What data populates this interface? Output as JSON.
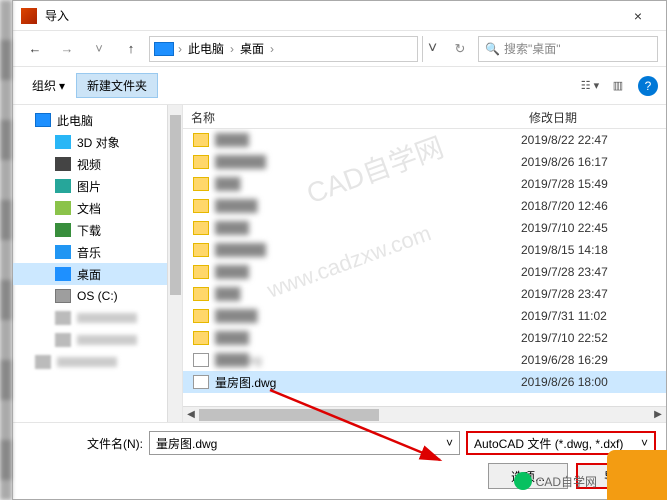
{
  "window": {
    "title": "导入",
    "close": "×"
  },
  "nav": {
    "crumb1": "此电脑",
    "crumb2": "桌面",
    "search_placeholder": "搜索\"桌面\""
  },
  "toolbar": {
    "organize": "组织",
    "newfolder": "新建文件夹"
  },
  "sidebar": {
    "items": [
      {
        "label": "此电脑",
        "cls": "pc",
        "indent": ""
      },
      {
        "label": "3D 对象",
        "cls": "obj",
        "indent": "child"
      },
      {
        "label": "视频",
        "cls": "video",
        "indent": "child"
      },
      {
        "label": "图片",
        "cls": "pic",
        "indent": "child"
      },
      {
        "label": "文档",
        "cls": "doc",
        "indent": "child"
      },
      {
        "label": "下载",
        "cls": "dl",
        "indent": "child"
      },
      {
        "label": "音乐",
        "cls": "music",
        "indent": "child"
      },
      {
        "label": "桌面",
        "cls": "desk",
        "indent": "child",
        "selected": true
      },
      {
        "label": "OS (C:)",
        "cls": "drive",
        "indent": "child"
      },
      {
        "label": "",
        "cls": "blur",
        "indent": "child"
      },
      {
        "label": "",
        "cls": "blur",
        "indent": "child"
      },
      {
        "label": "",
        "cls": "blur",
        "indent": ""
      }
    ]
  },
  "columns": {
    "name": "名称",
    "date": "修改日期"
  },
  "files": [
    {
      "name": "████",
      "date": "2019/8/22 22:47",
      "type": "folder",
      "blur": true
    },
    {
      "name": "██████",
      "date": "2019/8/26 16:17",
      "type": "folder",
      "blur": true
    },
    {
      "name": "███",
      "date": "2019/7/28 15:49",
      "type": "folder",
      "blur": true
    },
    {
      "name": "█████",
      "date": "2018/7/20 12:46",
      "type": "folder",
      "blur": true
    },
    {
      "name": "████",
      "date": "2019/7/10 22:45",
      "type": "folder",
      "blur": true
    },
    {
      "name": "██████",
      "date": "2019/8/15 14:18",
      "type": "folder",
      "blur": true
    },
    {
      "name": "████",
      "date": "2019/7/28 23:47",
      "type": "folder",
      "blur": true
    },
    {
      "name": "███",
      "date": "2019/7/28 23:47",
      "type": "folder",
      "blur": true
    },
    {
      "name": "█████",
      "date": "2019/7/31 11:02",
      "type": "folder",
      "blur": true
    },
    {
      "name": "████",
      "date": "2019/7/10 22:52",
      "type": "folder",
      "blur": true
    },
    {
      "name": "████vg",
      "date": "2019/6/28 16:29",
      "type": "dwg",
      "blur": true
    },
    {
      "name": "量房图.dwg",
      "date": "2019/8/26 18:00",
      "type": "dwg",
      "blur": false,
      "selected": true
    }
  ],
  "footer": {
    "fname_label": "文件名(N):",
    "fname_value": "量房图.dwg",
    "ftype_value": "AutoCAD 文件 (*.dwg, *.dxf)",
    "options": "选项...",
    "import": "导入"
  },
  "watermark": {
    "w1": "CAD自学网",
    "w2": "www.cadzxw.com"
  },
  "badge_text": "CAD自学网"
}
